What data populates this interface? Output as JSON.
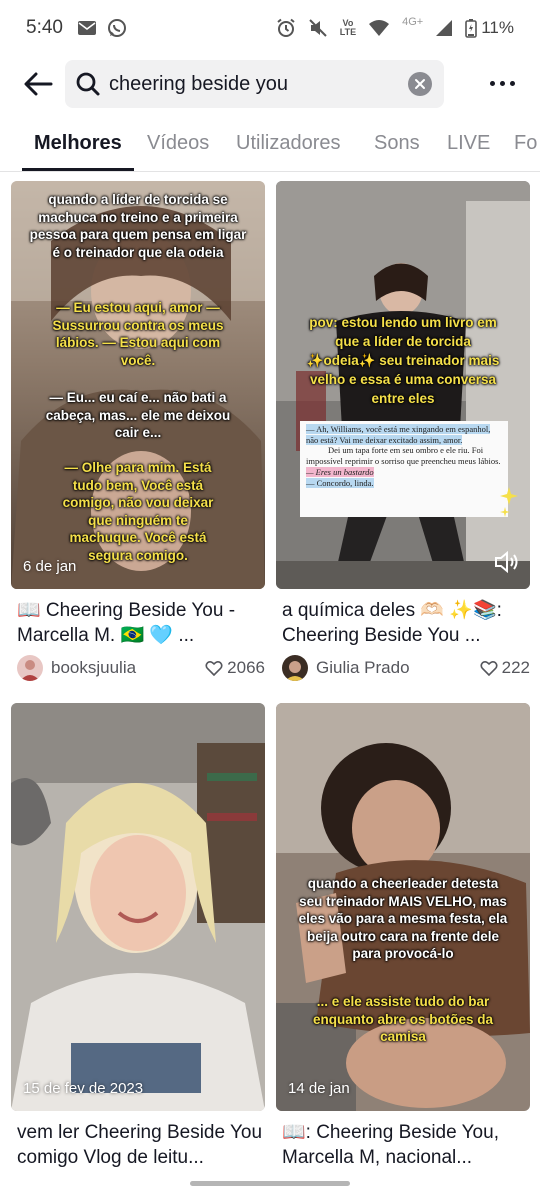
{
  "status_bar": {
    "time": "5:40",
    "icons_left": [
      "mail-icon",
      "whatsapp-icon"
    ],
    "icons_right": [
      "alarm-icon",
      "mute-icon",
      "volte-icon",
      "wifi-icon",
      "signal-icon",
      "battery-icon"
    ],
    "volte_top": "Vo",
    "volte_mid": "LTE",
    "network": "4G+",
    "battery": "11%"
  },
  "search": {
    "query": "cheering beside you"
  },
  "tabs": [
    "Melhores",
    "Vídeos",
    "Utilizadores",
    "Sons",
    "LIVE",
    "Fo"
  ],
  "active_tab": "Melhores",
  "results": [
    {
      "caption_lines_1": "quando a líder de torcida se machuca no treino e a primeira pessoa para quem pensa em ligar é o treinador que ela odeia",
      "caption_lines_2": "— Eu estou aqui, amor — Sussurrou contra os meus lábios. — Estou aqui com você.",
      "caption_lines_3": "— Eu... eu caí e... não bati a cabeça, mas... ele me deixou cair e...",
      "caption_lines_4": "— Olhe para mim. Está tudo bem, Você está comigo, não vou deixar que ninguém te machuque. Você está segura comigo.",
      "date": "6 de jan",
      "title": "📖 Cheering Beside You - Marcella M. 🇧🇷 🩵 ...",
      "author": "booksjuulia",
      "likes": "2066"
    },
    {
      "caption": "pov: estou lendo um livro em que a líder de torcida ✨odeia✨ seu treinador mais velho e essa é uma conversa entre eles",
      "book_line_1": "— Ah, Williams, você está me xingando em espanhol, não está? Vai me deixar excitado assim, amor.",
      "book_line_2": "Dei um tapa forte em seu ombro e ele riu. Foi impossível reprimir o sorriso que preencheu meus lábios.",
      "book_line_3": "— Eres un bastardo",
      "book_line_4": "— Concordo, linda.",
      "title": "a química deles 🫶🏻 ✨📚: Cheering Beside You ...",
      "author": "Giulia Prado",
      "likes": "222"
    },
    {
      "date": "15 de fev de 2023",
      "title": "vem ler Cheering Beside You comigo Vlog de leitu..."
    },
    {
      "caption_1": "quando a cheerleader detesta seu treinador MAIS VELHO, mas eles vão para a mesma festa, ela beija outro cara na frente dele para provocá-lo",
      "caption_2": "... e ele assiste tudo do bar enquanto abre os botões da camisa",
      "date": "14 de jan",
      "title": "📖: Cheering Beside You, Marcella M, nacional..."
    }
  ]
}
